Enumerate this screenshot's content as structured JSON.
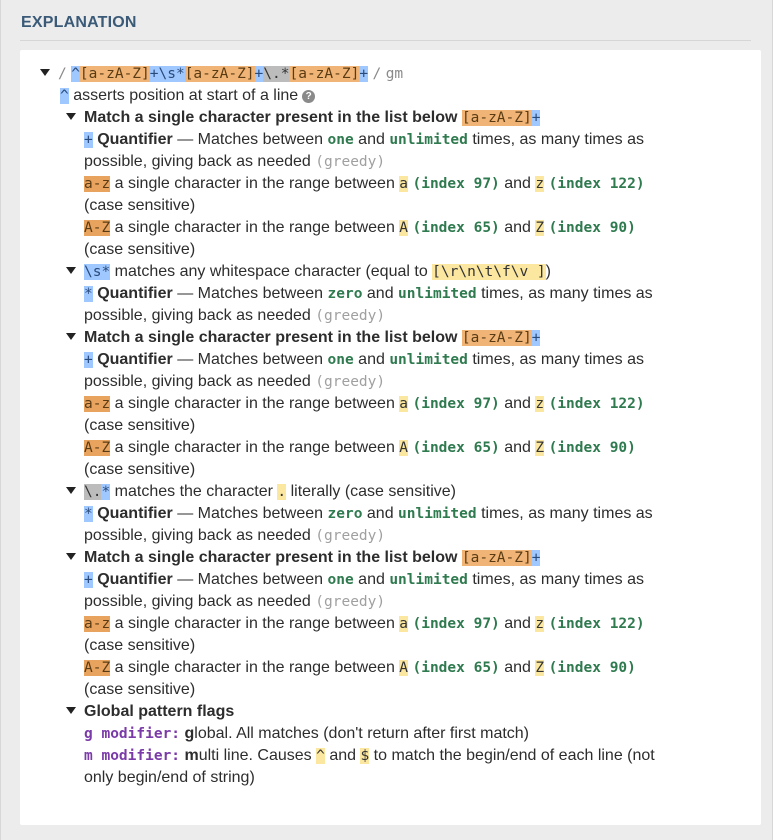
{
  "panel": {
    "title": "EXPLANATION"
  },
  "regex": {
    "open_slash": "/",
    "tokens": [
      "^",
      "[a-zA-Z]",
      "+",
      "\\s*",
      "[a-zA-Z]",
      "+",
      "\\.*",
      "[a-zA-Z]",
      "+"
    ],
    "close_slash": "/",
    "flags": "gm"
  },
  "anchor_line": {
    "token": "^",
    "text": "asserts position at start of a line"
  },
  "groups": [
    {
      "header": "Match a single character present in the list below",
      "header_token": "[a-zA-Z]",
      "quant_token": "+",
      "quant_sym": "+",
      "quant_label": "Quantifier",
      "quant_text_a": "— Matches between",
      "quant_min": "one",
      "quant_text_b": "and",
      "quant_max": "unlimited",
      "quant_text_c": "times, as many times as",
      "quant_text_d": "possible, giving back as needed",
      "greedy": "(greedy)",
      "range1_tok": "a-z",
      "range1_text": "a single character in the range between",
      "range1_a": "a",
      "range1_a_idx": "(index 97)",
      "range1_and": "and",
      "range1_b": "z",
      "range1_b_idx": "(index 122)",
      "range1_case": "(case sensitive)",
      "range2_tok": "A-Z",
      "range2_text": "a single character in the range between",
      "range2_a": "A",
      "range2_a_idx": "(index 65)",
      "range2_and": "and",
      "range2_b": "Z",
      "range2_b_idx": "(index 90)",
      "range2_case": "(case sensitive)"
    },
    {
      "ws_token": "\\s*",
      "ws_text": "matches any whitespace character (equal to",
      "ws_set": "[\\r\\n\\t\\f\\v ]",
      "ws_close": ")",
      "quant_sym": "*",
      "quant_label": "Quantifier",
      "quant_text_a": "— Matches between",
      "quant_min": "zero",
      "quant_text_b": "and",
      "quant_max": "unlimited",
      "quant_text_c": "times, as many times as",
      "quant_text_d": "possible, giving back as needed",
      "greedy": "(greedy)"
    },
    {
      "header": "Match a single character present in the list below",
      "header_token": "[a-zA-Z]",
      "quant_token": "+",
      "quant_sym": "+",
      "quant_label": "Quantifier",
      "quant_text_a": "— Matches between",
      "quant_min": "one",
      "quant_text_b": "and",
      "quant_max": "unlimited",
      "quant_text_c": "times, as many times as",
      "quant_text_d": "possible, giving back as needed",
      "greedy": "(greedy)",
      "range1_tok": "a-z",
      "range1_text": "a single character in the range between",
      "range1_a": "a",
      "range1_a_idx": "(index 97)",
      "range1_and": "and",
      "range1_b": "z",
      "range1_b_idx": "(index 122)",
      "range1_case": "(case sensitive)",
      "range2_tok": "A-Z",
      "range2_text": "a single character in the range between",
      "range2_a": "A",
      "range2_a_idx": "(index 65)",
      "range2_and": "and",
      "range2_b": "Z",
      "range2_b_idx": "(index 90)",
      "range2_case": "(case sensitive)"
    },
    {
      "dot_token": "\\.",
      "dot_star": "*",
      "dot_text": "matches the character",
      "dot_char": ".",
      "dot_text2": "literally (case sensitive)",
      "quant_sym": "*",
      "quant_label": "Quantifier",
      "quant_text_a": "— Matches between",
      "quant_min": "zero",
      "quant_text_b": "and",
      "quant_max": "unlimited",
      "quant_text_c": "times, as many times as",
      "quant_text_d": "possible, giving back as needed",
      "greedy": "(greedy)"
    },
    {
      "header": "Match a single character present in the list below",
      "header_token": "[a-zA-Z]",
      "quant_token": "+",
      "quant_sym": "+",
      "quant_label": "Quantifier",
      "quant_text_a": "— Matches between",
      "quant_min": "one",
      "quant_text_b": "and",
      "quant_max": "unlimited",
      "quant_text_c": "times, as many times as",
      "quant_text_d": "possible, giving back as needed",
      "greedy": "(greedy)",
      "range1_tok": "a-z",
      "range1_text": "a single character in the range between",
      "range1_a": "a",
      "range1_a_idx": "(index 97)",
      "range1_and": "and",
      "range1_b": "z",
      "range1_b_idx": "(index 122)",
      "range1_case": "(case sensitive)",
      "range2_tok": "A-Z",
      "range2_text": "a single character in the range between",
      "range2_a": "A",
      "range2_a_idx": "(index 65)",
      "range2_and": "and",
      "range2_b": "Z",
      "range2_b_idx": "(index 90)",
      "range2_case": "(case sensitive)"
    }
  ],
  "flags_section": {
    "header": "Global pattern flags",
    "g_mod": "g modifier:",
    "g_first": "g",
    "g_rest": "lobal. All matches (don't return after first match)",
    "m_mod": "m modifier:",
    "m_first": "m",
    "m_rest": "ulti line. Causes",
    "m_caret": "^",
    "m_and": "and",
    "m_dollar": "$",
    "m_rest2": "to match the begin/end of each line (not",
    "m_rest3": "only begin/end of string)"
  }
}
